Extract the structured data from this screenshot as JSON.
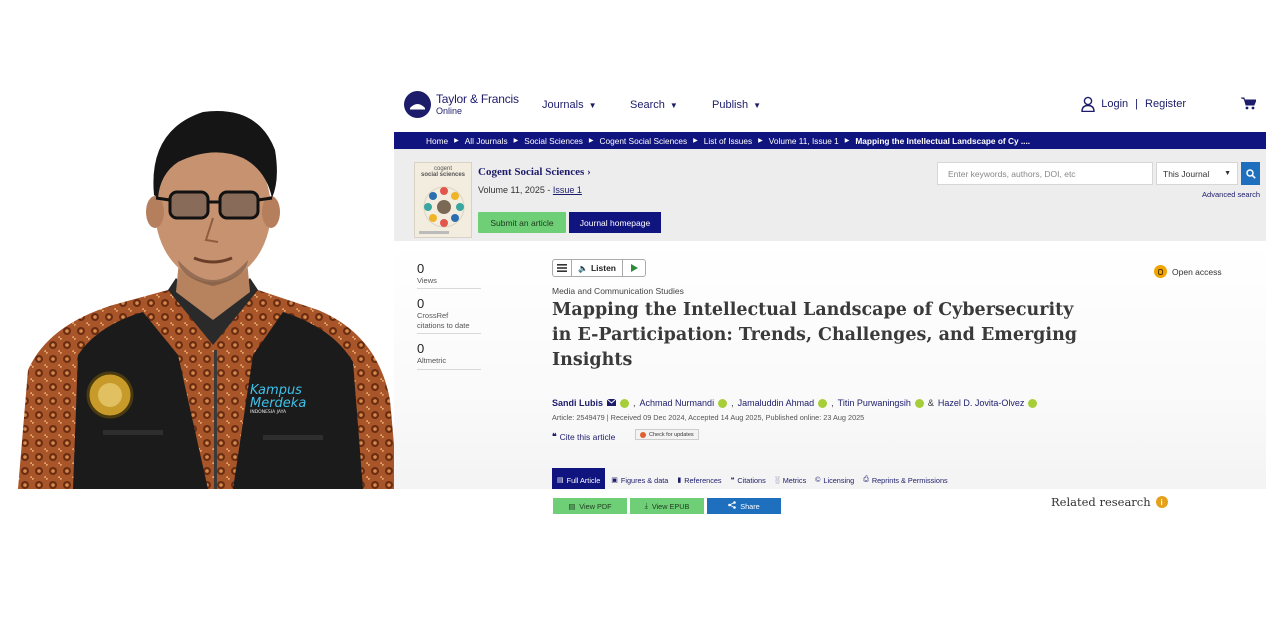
{
  "portrait": {
    "vest_logo_line1": "Kampus",
    "vest_logo_line2": "Merdeka",
    "vest_logo_line3": "INDONESIA JAYA"
  },
  "site": {
    "logo_line1": "Taylor & Francis",
    "logo_line2": "Online",
    "nav": [
      "Journals",
      "Search",
      "Publish"
    ],
    "login": "Login",
    "login_sep": "|",
    "register": "Register"
  },
  "breadcrumb": [
    "Home",
    "All Journals",
    "Social Sciences",
    "Cogent Social Sciences",
    "List of Issues",
    "Volume 11, Issue 1",
    "Mapping the Intellectual Landscape of Cy ...."
  ],
  "journal": {
    "cover_title_line1": "cogent",
    "cover_title_line2": "social sciences",
    "name": "Cogent Social Sciences ›",
    "volume_text": "Volume 11, 2025 - ",
    "issue_link": "Issue 1",
    "submit_button": "Submit an article",
    "home_button": "Journal homepage"
  },
  "search": {
    "placeholder": "Enter keywords, authors, DOI, etc",
    "scope": "This Journal",
    "advanced": "Advanced search"
  },
  "metrics": [
    {
      "value": "0",
      "label_line1": "Views",
      "label_line2": ""
    },
    {
      "value": "0",
      "label_line1": "CrossRef",
      "label_line2": "citations to date"
    },
    {
      "value": "0",
      "label_line1": "Altmetric",
      "label_line2": ""
    }
  ],
  "article": {
    "listen": "Listen",
    "open_access": "Open access",
    "type": "Media and Communication Studies",
    "title_line1": "Mapping the Intellectual Landscape of Cybersecurity",
    "title_line2": "in E-Participation: Trends, Challenges, and Emerging",
    "title_line3": "Insights",
    "authors": [
      "Sandi Lubis",
      "Achmad Nurmandi",
      "Jamaluddin Ahmad",
      "Titin Purwaningsih",
      "Hazel D. Jovita-Olvez"
    ],
    "author_sep": ",",
    "author_amp": "&",
    "dates": "Article: 2549479 | Received 09 Dec 2024, Accepted 14 Aug 2025, Published online: 23 Aug 2025",
    "cite": "Cite this article",
    "check_updates": "Check for updates"
  },
  "tabs": [
    "Full Article",
    "Figures & data",
    "References",
    "Citations",
    "Metrics",
    "Licensing",
    "Reprints & Permissions"
  ],
  "actions": {
    "pdf": "View PDF",
    "epub": "View EPUB",
    "share": "Share",
    "related": "Related research",
    "related_icon": "i"
  },
  "colors": {
    "navy": "#10147e",
    "green": "#6fcf76",
    "blue": "#1f6fbf",
    "orcid": "#a6ce39",
    "open_access": "#f1a300"
  }
}
